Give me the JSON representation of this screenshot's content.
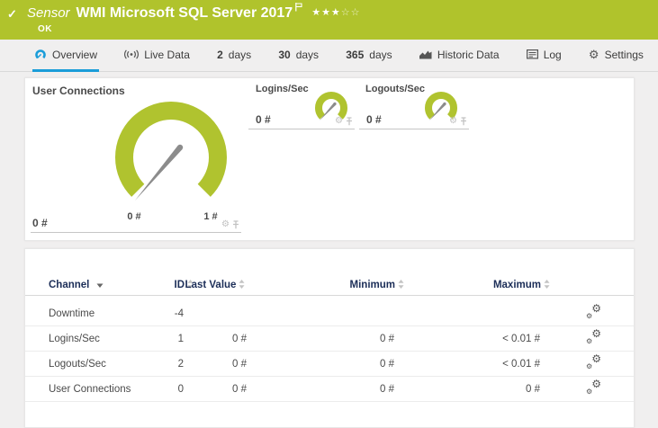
{
  "sensor_header": {
    "check": "✓",
    "kind": "Sensor",
    "title": "WMI Microsoft SQL Server 2017",
    "status": "OK",
    "stars_filled": "★★★",
    "stars_empty": "☆☆"
  },
  "tabs": {
    "overview": {
      "label": "Overview"
    },
    "live_data": {
      "label": "Live Data"
    },
    "days2": {
      "num": "2",
      "label": "days"
    },
    "days30": {
      "num": "30",
      "label": "days"
    },
    "days365": {
      "num": "365",
      "label": "days"
    },
    "historic": {
      "label": "Historic Data"
    },
    "log": {
      "label": "Log"
    },
    "settings": {
      "label": "Settings"
    }
  },
  "gauges": {
    "main": {
      "title": "User Connections",
      "value": "0 #",
      "scale_min": "0 #",
      "scale_max": "1 #"
    },
    "logins": {
      "title": "Logins/Sec",
      "value": "0 #"
    },
    "logouts": {
      "title": "Logouts/Sec",
      "value": "0 #"
    }
  },
  "table": {
    "headers": {
      "channel": "Channel",
      "id": "ID",
      "last_value": "Last Value",
      "minimum": "Minimum",
      "maximum": "Maximum"
    },
    "rows": [
      {
        "channel": "Downtime",
        "id": "-4",
        "last": "",
        "min": "",
        "max": ""
      },
      {
        "channel": "Logins/Sec",
        "id": "1",
        "last": "0 #",
        "min": "0 #",
        "max": "< 0.01 #"
      },
      {
        "channel": "Logouts/Sec",
        "id": "2",
        "last": "0 #",
        "min": "0 #",
        "max": "< 0.01 #"
      },
      {
        "channel": "User Connections",
        "id": "0",
        "last": "0 #",
        "min": "0 #",
        "max": "0 #"
      }
    ]
  },
  "colors": {
    "brand_green": "#b0c32c",
    "gauge_green": "#b0c32f",
    "accent_blue": "#1b9dd9",
    "table_header_navy": "#1c2e58"
  }
}
